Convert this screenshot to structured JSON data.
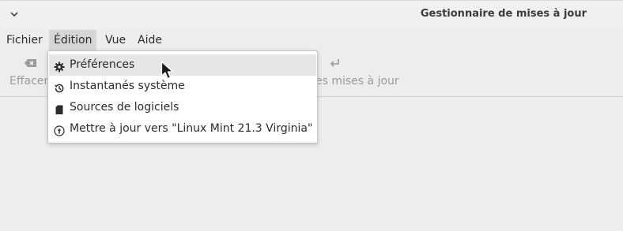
{
  "window": {
    "title": "Gestionnaire de mises à jour"
  },
  "menubar": {
    "items": [
      {
        "label": "Fichier"
      },
      {
        "label": "Édition"
      },
      {
        "label": "Vue"
      },
      {
        "label": "Aide"
      }
    ]
  },
  "toolbar": {
    "clear_label": "Effacer",
    "refresh_label": "es mises à jour"
  },
  "edit_menu": {
    "items": [
      {
        "label": "Préférences",
        "icon": "gear-icon"
      },
      {
        "label": "Instantanés système",
        "icon": "history-icon"
      },
      {
        "label": "Sources de logiciels",
        "icon": "sd-card-icon"
      },
      {
        "label": "Mettre à jour vers \"Linux Mint 21.3 Virginia\"",
        "icon": "upgrade-arrow-icon"
      }
    ]
  },
  "colors": {
    "menu_active_bg": "#d6d6d6",
    "menu_hover_bg": "#e6e6e6",
    "window_bg": "#ededed",
    "disabled_text": "#9a9a9a"
  }
}
